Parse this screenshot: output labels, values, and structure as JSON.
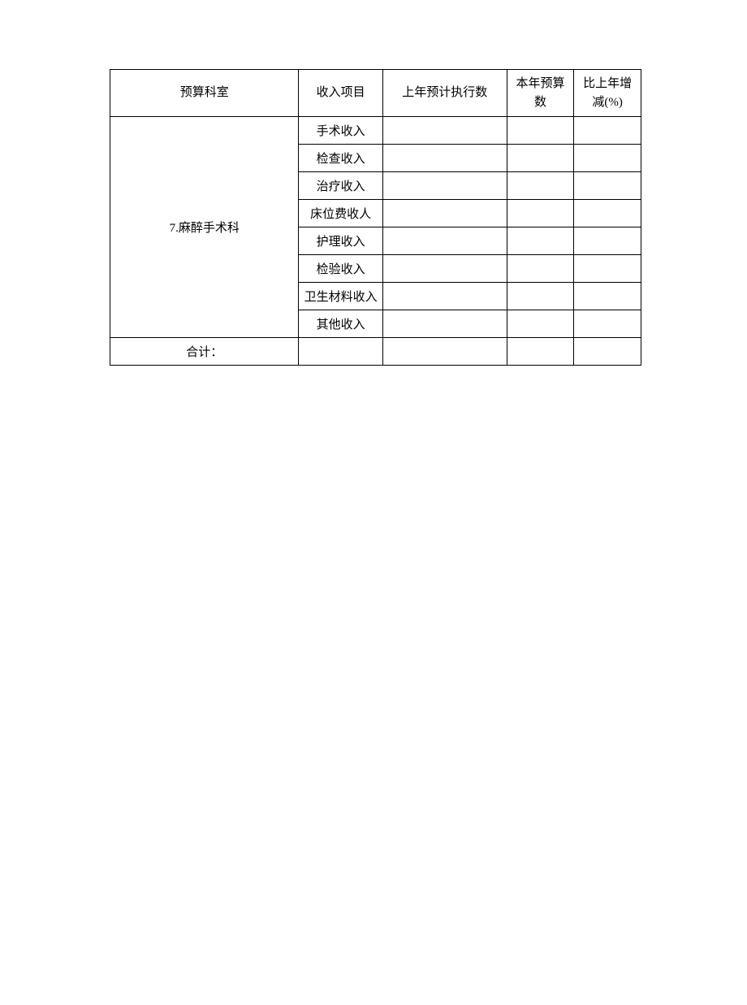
{
  "headers": {
    "department": "预算科室",
    "item": "收入项目",
    "prev_year": "上年预计执行数",
    "this_year": "本年预算数",
    "change_pct": "比上年增减(%)"
  },
  "sections": [
    {
      "department_label": "7.麻醉手术科",
      "items": [
        {
          "label": "手术收入",
          "prev": "",
          "budget": "",
          "pct": ""
        },
        {
          "label": "检查收入",
          "prev": "",
          "budget": "",
          "pct": ""
        },
        {
          "label": "治疗收入",
          "prev": "",
          "budget": "",
          "pct": ""
        },
        {
          "label": "床位费收人",
          "prev": "",
          "budget": "",
          "pct": ""
        },
        {
          "label": "护理收入",
          "prev": "",
          "budget": "",
          "pct": ""
        },
        {
          "label": "检验收入",
          "prev": "",
          "budget": "",
          "pct": ""
        },
        {
          "label": "卫生材料收入",
          "prev": "",
          "budget": "",
          "pct": ""
        },
        {
          "label": "其他收入",
          "prev": "",
          "budget": "",
          "pct": ""
        }
      ]
    }
  ],
  "total_row": {
    "label": "合计：",
    "item": "",
    "prev": "",
    "budget": "",
    "pct": ""
  }
}
